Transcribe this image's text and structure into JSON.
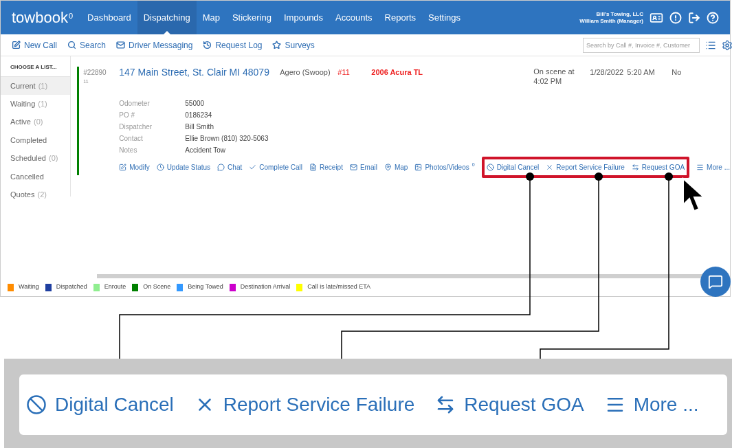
{
  "app": {
    "logo": "towbook",
    "logo_mark": "0"
  },
  "nav": [
    {
      "label": "Dashboard",
      "selected": false
    },
    {
      "label": "Dispatching",
      "selected": true
    },
    {
      "label": "Map",
      "selected": false
    },
    {
      "label": "Stickering",
      "selected": false
    },
    {
      "label": "Impounds",
      "selected": false
    },
    {
      "label": "Accounts",
      "selected": false
    },
    {
      "label": "Reports",
      "selected": false
    },
    {
      "label": "Settings",
      "selected": false
    }
  ],
  "account": {
    "company": "Bill's Towing, LLC",
    "user": "William Smith (Manager)"
  },
  "toolbar": [
    {
      "label": "New Call"
    },
    {
      "label": "Search"
    },
    {
      "label": "Driver Messaging"
    },
    {
      "label": "Request Log"
    },
    {
      "label": "Surveys"
    }
  ],
  "search": {
    "placeholder": "Search by Call #, Invoice #, Customer"
  },
  "sidebar": {
    "heading": "CHOOSE A LIST...",
    "items": [
      {
        "label": "Current",
        "count": "(1)",
        "selected": true
      },
      {
        "label": "Waiting",
        "count": "(1)",
        "selected": false
      },
      {
        "label": "Active",
        "count": "(0)",
        "selected": false
      },
      {
        "label": "Completed",
        "selected": false
      },
      {
        "label": "Scheduled",
        "count": "(0)",
        "selected": false
      },
      {
        "label": "Cancelled",
        "selected": false
      },
      {
        "label": "Quotes",
        "count": "(2)",
        "selected": false
      }
    ]
  },
  "call": {
    "number": "#22890",
    "sub": "11",
    "address": "147 Main Street, St. Clair MI 48079",
    "account": "Agero (Swoop)",
    "po_ref": "#11",
    "vehicle": "2006 Acura TL",
    "eta": "On scene at 4:02 PM",
    "date": "1/28/2022",
    "time": "5:20 AM",
    "column_9": "No",
    "details": [
      {
        "label": "Odometer",
        "value": "55000"
      },
      {
        "label": "PO #",
        "value": "0186234"
      },
      {
        "label": "Dispatcher",
        "value": "Bill Smith"
      },
      {
        "label": "Contact",
        "value": "Ellie Brown (810) 320-5063"
      },
      {
        "label": "Notes",
        "value": "Accident Tow"
      }
    ],
    "action_groups": [
      {
        "highlighted": false,
        "items": [
          {
            "label": "Modify"
          },
          {
            "label": "Update Status"
          },
          {
            "label": "Chat"
          },
          {
            "label": "Complete Call"
          },
          {
            "label": "Receipt"
          },
          {
            "label": "Email"
          },
          {
            "label": "Map"
          },
          {
            "label": "Photos/Videos",
            "sup": "0"
          }
        ]
      },
      {
        "highlighted": true,
        "items": [
          {
            "label": "Digital Cancel"
          },
          {
            "label": "Report Service Failure"
          },
          {
            "label": "Request GOA"
          }
        ]
      },
      {
        "highlighted": false,
        "items": [
          {
            "label": "More ..."
          }
        ]
      }
    ]
  },
  "legend": [
    {
      "label": "Waiting",
      "color": "#ff8c00"
    },
    {
      "label": "Dispatched",
      "color": "#1f3fa0"
    },
    {
      "label": "Enroute",
      "color": "#90ee90"
    },
    {
      "label": "On Scene",
      "color": "#008000"
    },
    {
      "label": "Being Towed",
      "color": "#3399ff"
    },
    {
      "label": "Destination Arrival",
      "color": "#cc00cc"
    },
    {
      "label": "Call is late/missed ETA",
      "color": "#ffff00"
    }
  ],
  "callout": [
    {
      "label": "Digital Cancel"
    },
    {
      "label": "Report Service Failure"
    },
    {
      "label": "Request GOA"
    },
    {
      "label": "More ..."
    }
  ]
}
